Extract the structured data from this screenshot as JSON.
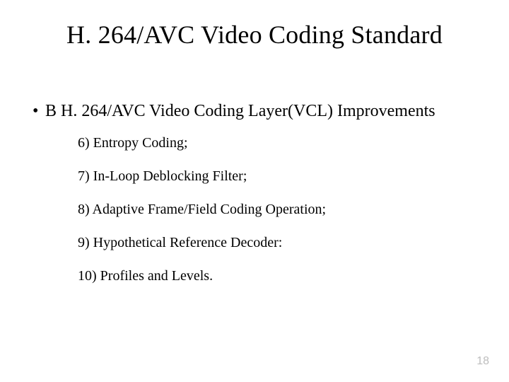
{
  "slide": {
    "title": "H. 264/AVC Video Coding Standard",
    "bullet": {
      "marker": "•",
      "text": "B H. 264/AVC Video Coding Layer(VCL) Improvements"
    },
    "items": [
      "6) Entropy Coding;",
      "7) In-Loop Deblocking Filter;",
      "8) Adaptive Frame/Field Coding Operation;",
      "9) Hypothetical Reference Decoder:",
      "10) Profiles and Levels."
    ],
    "page_number": "18"
  }
}
